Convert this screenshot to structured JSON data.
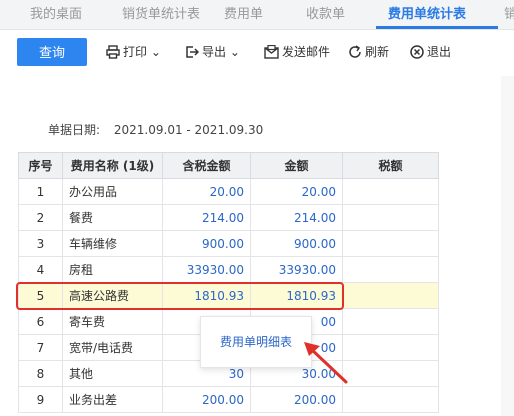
{
  "tabs": [
    {
      "label": "我的桌面",
      "active": false
    },
    {
      "label": "销货单统计表",
      "active": false
    },
    {
      "label": "费用单",
      "active": false
    },
    {
      "label": "收款单",
      "active": false
    },
    {
      "label": "费用单统计表",
      "active": true
    },
    {
      "label": "销",
      "active": false
    }
  ],
  "toolbar": {
    "query_label": "查询",
    "print_label": "打印",
    "export_label": "导出",
    "email_label": "发送邮件",
    "refresh_label": "刷新",
    "exit_label": "退出"
  },
  "date_filter": {
    "label": "单据日期:",
    "value": "2021.09.01 - 2021.09.30"
  },
  "table": {
    "headers": [
      "序号",
      "费用名称 (1级)",
      "含税金额",
      "金额",
      "税额"
    ],
    "rows": [
      {
        "no": "1",
        "name": "办公用品",
        "tax_incl": "20.00",
        "amount": "20.00",
        "tax": ""
      },
      {
        "no": "2",
        "name": "餐费",
        "tax_incl": "214.00",
        "amount": "214.00",
        "tax": ""
      },
      {
        "no": "3",
        "name": "车辆维修",
        "tax_incl": "900.00",
        "amount": "900.00",
        "tax": ""
      },
      {
        "no": "4",
        "name": "房租",
        "tax_incl": "33930.00",
        "amount": "33930.00",
        "tax": ""
      },
      {
        "no": "5",
        "name": "高速公路费",
        "tax_incl": "1810.93",
        "amount": "1810.93",
        "tax": ""
      },
      {
        "no": "6",
        "name": "寄车费",
        "tax_incl": "",
        "amount": "00",
        "tax": ""
      },
      {
        "no": "7",
        "name": "宽带/电话费",
        "tax_incl": "",
        "amount": "00",
        "tax": ""
      },
      {
        "no": "8",
        "name": "其他",
        "tax_incl": "30",
        "amount": "30.00",
        "tax": ""
      },
      {
        "no": "9",
        "name": "业务出差",
        "tax_incl": "200.00",
        "amount": "200.00",
        "tax": ""
      }
    ],
    "selected_row": 5
  },
  "context_menu": {
    "item_label": "费用单明细表"
  },
  "colors": {
    "accent": "#2a7be4",
    "highlight": "#e0302a",
    "selected_row_bg": "#fdfbd6"
  }
}
